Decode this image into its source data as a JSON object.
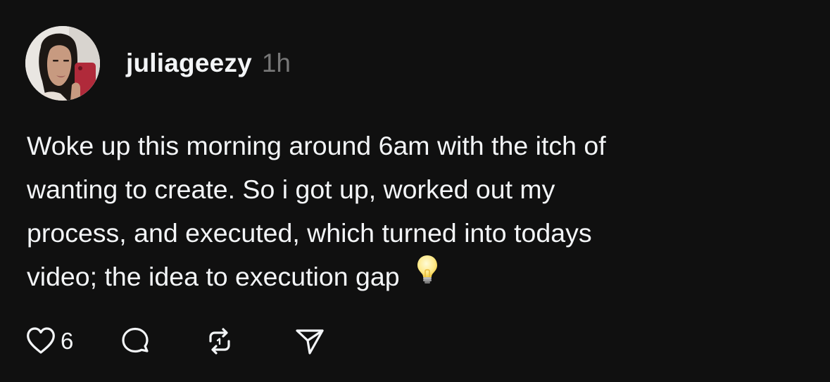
{
  "post": {
    "author": {
      "username": "juliageezy",
      "timestamp": "1h"
    },
    "text_lines": [
      "Woke up this morning around 6am with the itch of",
      "wanting to create. So i got up, worked out my",
      "process, and executed, which turned into todays",
      "video; the idea to execution gap"
    ],
    "trailing_emoji": "lightbulb",
    "actions": {
      "like_count": "6",
      "like_icon": "heart-icon",
      "comment_icon": "comment-bubble-icon",
      "repost_icon": "repost-icon",
      "share_icon": "send-icon"
    }
  },
  "colors": {
    "background": "#101010",
    "primary_text": "#f3f5f7",
    "secondary_text": "#777777"
  }
}
